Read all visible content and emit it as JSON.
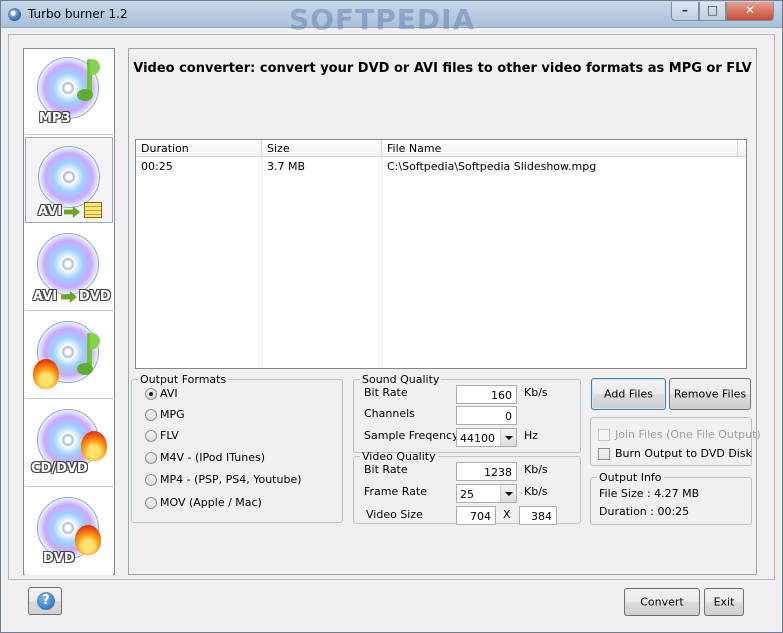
{
  "window": {
    "title": "Turbo burner 1.2",
    "watermark": "SOFTPEDIA",
    "minimize_glyph": "–",
    "maximize_glyph": "□",
    "close_glyph": "✕"
  },
  "sidebar": {
    "items": [
      {
        "label": "MP3",
        "icon": "mp3-disc-icon"
      },
      {
        "label": "AVI",
        "icon": "avi-disc-icon"
      },
      {
        "label_left": "AVI",
        "label_right": "DVD",
        "icon": "avi-to-dvd-icon"
      },
      {
        "label": "",
        "icon": "burn-audio-icon"
      },
      {
        "label": "CD/DVD",
        "icon": "burn-cd-dvd-icon"
      },
      {
        "label": "DVD",
        "icon": "burn-dvd-icon"
      }
    ]
  },
  "header": {
    "title": "Video converter: convert your DVD or AVI files to other video formats as MPG or FLV"
  },
  "file_list": {
    "columns": [
      "Duration",
      "Size",
      "File Name"
    ],
    "rows": [
      {
        "duration": "00:25",
        "size": "3.7 MB",
        "file_name": "C:\\Softpedia\\Softpedia Slideshow.mpg"
      }
    ]
  },
  "output_formats": {
    "title": "Output Formats",
    "selected": "AVI",
    "options": [
      "AVI",
      "MPG",
      "FLV",
      "M4V - (IPod ITunes)",
      "MP4 - (PSP, PS4, Youtube)",
      "MOV (Apple / Mac)"
    ]
  },
  "sound_quality": {
    "title": "Sound Quality",
    "bit_rate_label": "Bit Rate",
    "bit_rate_value": "160",
    "bit_rate_unit": "Kb/s",
    "channels_label": "Channels",
    "channels_value": "0",
    "sample_label": "Sample Freqency",
    "sample_value": "44100",
    "sample_unit": "Hz"
  },
  "video_quality": {
    "title": "Video Quality",
    "bit_rate_label": "Bit Rate",
    "bit_rate_value": "1238",
    "bit_rate_unit": "Kb/s",
    "frame_rate_label": "Frame Rate",
    "frame_rate_value": "25",
    "frame_rate_unit": "Kb/s",
    "video_size_label": "Video Size",
    "width": "704",
    "x_sep": "X",
    "height": "384"
  },
  "actions": {
    "add_files": "Add Files",
    "remove_files": "Remove Files"
  },
  "options": {
    "join_files": "Join Files (One File Output)",
    "burn_output": "Burn Output to DVD Disk"
  },
  "output_info": {
    "title": "Output Info",
    "file_size": "File Size : 4.27 MB",
    "duration": "Duration  : 00:25"
  },
  "footer": {
    "help": "?",
    "convert": "Convert",
    "exit": "Exit"
  }
}
